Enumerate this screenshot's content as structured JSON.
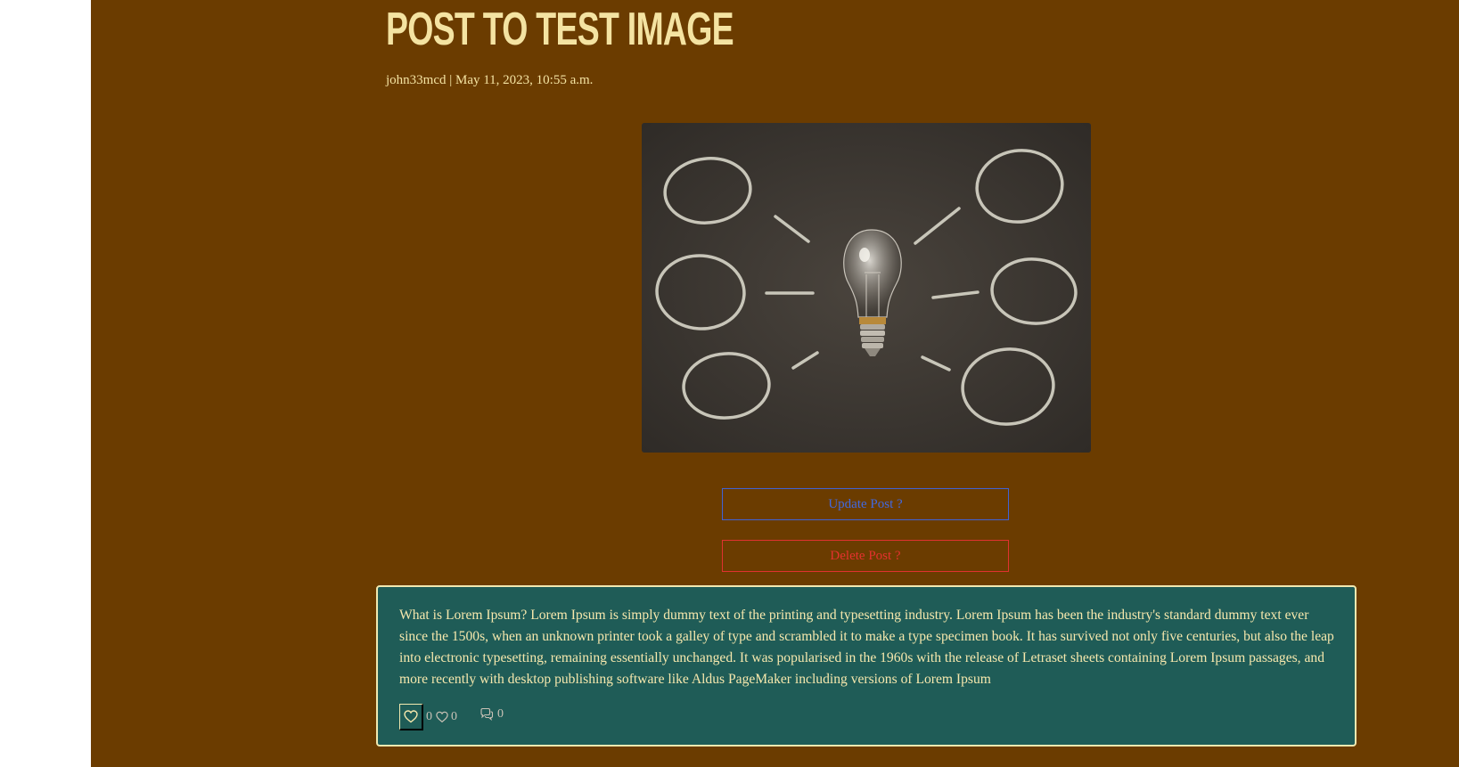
{
  "post": {
    "title": "POST TO TEST IMAGE",
    "meta": "john33mcd | May 11, 2023, 10:55 a.m.",
    "image": {
      "alt": "Light bulb on chalkboard with chalk circles",
      "icon": "lightbulb-chalkboard-image"
    },
    "buttons": {
      "update": "Update Post ?",
      "delete": "Delete Post ?"
    },
    "body": "What is Lorem Ipsum? Lorem Ipsum is simply dummy text of the printing and typesetting industry. Lorem Ipsum has been the industry's standard dummy text ever since the 1500s, when an unknown printer took a galley of type and scrambled it to make a type specimen book. It has survived not only five centuries, but also the leap into electronic typesetting, remaining essentially unchanged. It was popularised in the 1960s with the release of Letraset sheets containing Lorem Ipsum passages, and more recently with desktop publishing software like Aldus PageMaker including versions of Lorem Ipsum",
    "stats": {
      "like_count": "0",
      "heart_count": "0",
      "comment_count": "0"
    }
  },
  "colors": {
    "background": "#6b3c00",
    "title": "#f4e3a2",
    "card": "#1f5c57",
    "update_accent": "#4169e1",
    "delete_accent": "#e5322e"
  }
}
